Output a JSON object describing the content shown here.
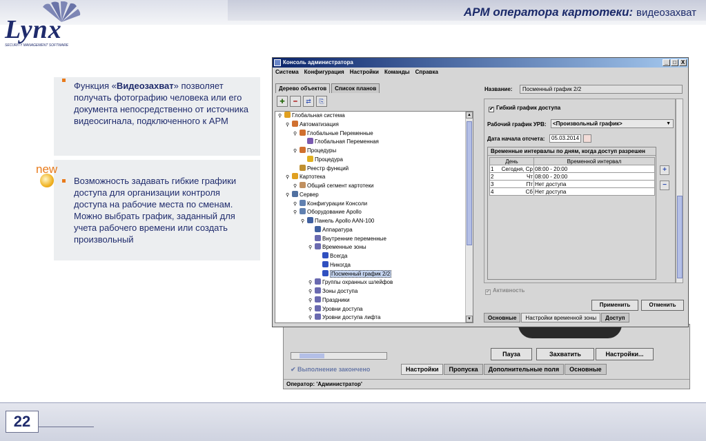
{
  "header": {
    "title_main": "АРМ оператора картотеки:",
    "title_sub": "видеозахват"
  },
  "logo": {
    "word": "Lynx",
    "tagline": "SECURITY MANAGEMENT SOFTWARE"
  },
  "card1": {
    "pre": "Функция «",
    "bold": "Видеозахват",
    "post": "» позволяет получать фотографию человека или его документа непосредственно от источника видеосигнала, подключенного к АРМ"
  },
  "new_badge": "new",
  "card2": {
    "text": "Возможность задавать гибкие графики доступа для организации контроля доступа на рабочие места по сменам. Можно выбрать график, заданный для учета рабочего времени или создать произвольный"
  },
  "page_number": "22",
  "window": {
    "title": "Консоль администратора",
    "buttons": [
      "_",
      "□",
      "X"
    ],
    "menu": [
      "Система",
      "Конфигурация",
      "Настройки",
      "Команды",
      "Справка"
    ],
    "left_tabs": [
      "Дерево объектов",
      "Список планов"
    ],
    "tree": [
      {
        "label": "Глобальная система",
        "level": 0,
        "color": "#e0a020"
      },
      {
        "label": "Автоматизация",
        "level": 1,
        "color": "#d07030"
      },
      {
        "label": "Глобальные Переменные",
        "level": 2,
        "color": "#d07030"
      },
      {
        "label": "Глобальная Переменная",
        "level": 3,
        "color": "#7a5ab0"
      },
      {
        "label": "Процедуры",
        "level": 2,
        "color": "#d07030"
      },
      {
        "label": "Процедура",
        "level": 3,
        "color": "#e0b020"
      },
      {
        "label": "Реестр функций",
        "level": 2,
        "color": "#c09030"
      },
      {
        "label": "Картотека",
        "level": 1,
        "color": "#e0a020"
      },
      {
        "label": "Общий сегмент картотеки",
        "level": 2,
        "color": "#c09060"
      },
      {
        "label": "Сервер",
        "level": 1,
        "color": "#5070a0"
      },
      {
        "label": "Конфигурации Консоли",
        "level": 2,
        "color": "#6080b0"
      },
      {
        "label": "Оборудование Apollo",
        "level": 2,
        "color": "#6080b0"
      },
      {
        "label": "Панель Apollo AAN-100",
        "level": 3,
        "color": "#4060a0"
      },
      {
        "label": "Аппаратура",
        "level": 4,
        "color": "#4060a0"
      },
      {
        "label": "Внутренние переменные",
        "level": 4,
        "color": "#6a6ab0"
      },
      {
        "label": "Временные зоны",
        "level": 4,
        "color": "#6a6ab0"
      },
      {
        "label": "Всегда",
        "level": 5,
        "color": "#3050c0"
      },
      {
        "label": "Никогда",
        "level": 5,
        "color": "#3050c0"
      },
      {
        "label": "Посменный график 2/2",
        "level": 5,
        "color": "#3050c0",
        "selected": true
      },
      {
        "label": "Группы охранных шлейфов",
        "level": 4,
        "color": "#6a6ab0"
      },
      {
        "label": "Зоны доступа",
        "level": 4,
        "color": "#6a6ab0"
      },
      {
        "label": "Праздники",
        "level": 4,
        "color": "#6a6ab0"
      },
      {
        "label": "Уровни доступа",
        "level": 4,
        "color": "#6a6ab0"
      },
      {
        "label": "Уровни доступа лифта",
        "level": 4,
        "color": "#6a6ab0"
      }
    ],
    "right": {
      "name_label": "Название:",
      "name_value": "Посменный график 2/2",
      "flexible_label": "Гибкий график доступа",
      "urv_label": "Рабочий график УРВ:",
      "urv_value": "<Произвольный график>",
      "date_label": "Дата начала отсчета:",
      "date_value": "05.03.2014",
      "table_caption": "Временные интервалы по дням, когда доступ разрешен",
      "table_headers": [
        "День",
        "Временной интервал"
      ],
      "rows": [
        {
          "num": "1",
          "day": "Сегодня, Ср",
          "interval": "08:00 - 20:00"
        },
        {
          "num": "2",
          "day": "Чт",
          "interval": "08:00 - 20:00"
        },
        {
          "num": "3",
          "day": "Пт",
          "interval": "Нет доступа"
        },
        {
          "num": "4",
          "day": "Сб",
          "interval": "Нет доступа"
        }
      ],
      "activity_label": "Активность",
      "apply": "Применить",
      "cancel": "Отменить",
      "bottom_tabs": [
        "Основные",
        "Настройки временной зоны",
        "Доступ"
      ]
    }
  },
  "background_window": {
    "status_text": "Выполнение закончено",
    "operator": "Оператор: 'Администратор'",
    "buttons": [
      "Пауза",
      "Захватить",
      "Настройки..."
    ],
    "tabs": [
      "Настройки",
      "Пропуска",
      "Дополнительные поля",
      "Основные"
    ]
  }
}
